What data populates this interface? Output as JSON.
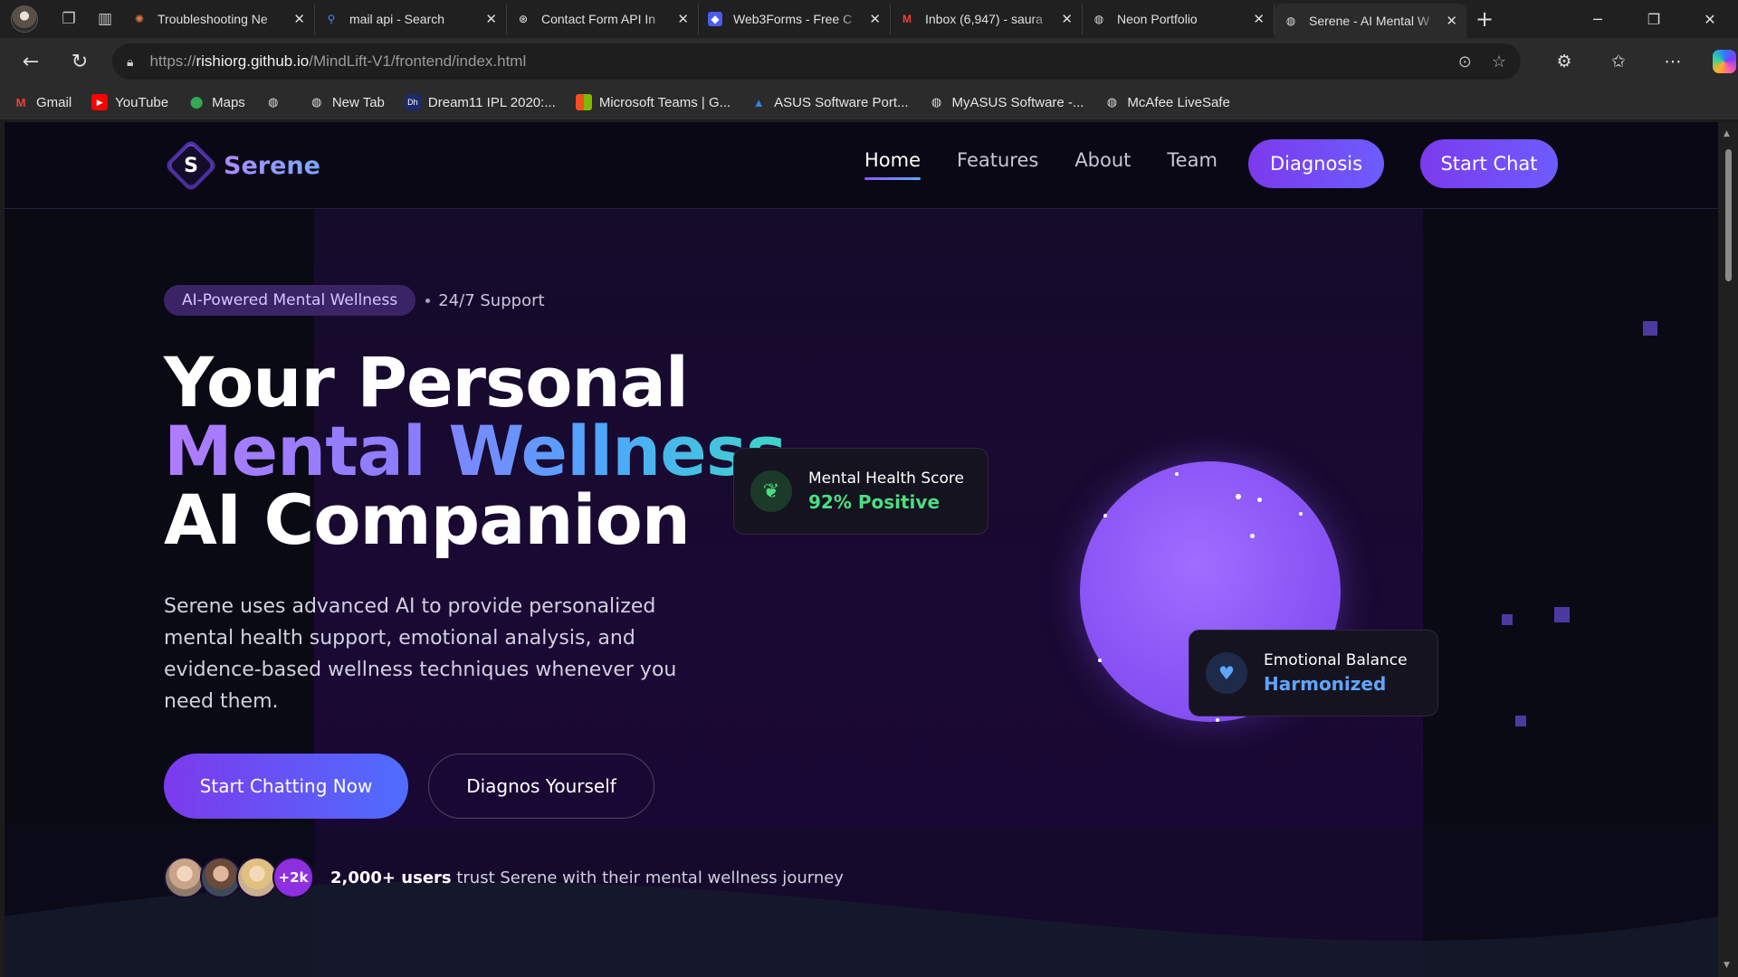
{
  "browser": {
    "tabs": [
      {
        "title": "Troubleshooting Ne",
        "icon": "claude-icon"
      },
      {
        "title": "mail api - Search",
        "icon": "search-icon"
      },
      {
        "title": "Contact Form API In",
        "icon": "openai-icon"
      },
      {
        "title": "Web3Forms - Free C",
        "icon": "cube-icon"
      },
      {
        "title": "Inbox (6,947) - saura",
        "icon": "gmail-icon"
      },
      {
        "title": "Neon Portfolio",
        "icon": "globe-icon"
      },
      {
        "title": "Serene - AI Mental W",
        "icon": "globe-icon",
        "active": true
      }
    ],
    "url_prefix": "https://",
    "url_host": "rishiorg.github.io",
    "url_path": "/MindLift-V1/frontend/index.html",
    "bookmarks": [
      {
        "label": "Gmail",
        "icon": "gmail-icon"
      },
      {
        "label": "YouTube",
        "icon": "youtube-icon"
      },
      {
        "label": "Maps",
        "icon": "maps-icon"
      },
      {
        "label": "",
        "icon": "globe-icon"
      },
      {
        "label": "New Tab",
        "icon": "globe-icon"
      },
      {
        "label": "Dream11 IPL 2020:...",
        "icon": "dream11-icon"
      },
      {
        "label": "Microsoft Teams | G...",
        "icon": "microsoft-icon"
      },
      {
        "label": "ASUS Software Port...",
        "icon": "asus-icon"
      },
      {
        "label": "MyASUS Software -...",
        "icon": "globe-icon"
      },
      {
        "label": "McAfee LiveSafe",
        "icon": "globe-icon"
      }
    ]
  },
  "site": {
    "logo_letter": "S",
    "brand": "Serene",
    "nav": [
      "Home",
      "Features",
      "About",
      "Team"
    ],
    "nav_active": "Home",
    "diagnosis_btn": "Diagnosis",
    "start_chat_btn": "Start Chat",
    "badge": "AI-Powered Mental Wellness",
    "support": "24/7 Support",
    "title_line1": "Your Personal",
    "title_line2": "Mental Wellness",
    "title_line3": "AI Companion",
    "description": "Serene uses advanced AI to provide personalized mental health support, emotional analysis, and evidence-based wellness techniques whenever you need them.",
    "cta_primary": "Start Chatting Now",
    "cta_secondary": "Diagnos Yourself",
    "users_more": "+2k",
    "users_count": "2,000+ users",
    "users_text": " trust Serene with their mental wellness journey",
    "card1_title": "Mental Health Score",
    "card1_value": "92% Positive",
    "card2_title": "Emotional Balance",
    "card2_value": "Harmonized"
  },
  "colors": {
    "accent": "#7c3aed",
    "positive": "#4ade80",
    "harmonized": "#60a5fa",
    "page_bg": "#0a0a14"
  }
}
